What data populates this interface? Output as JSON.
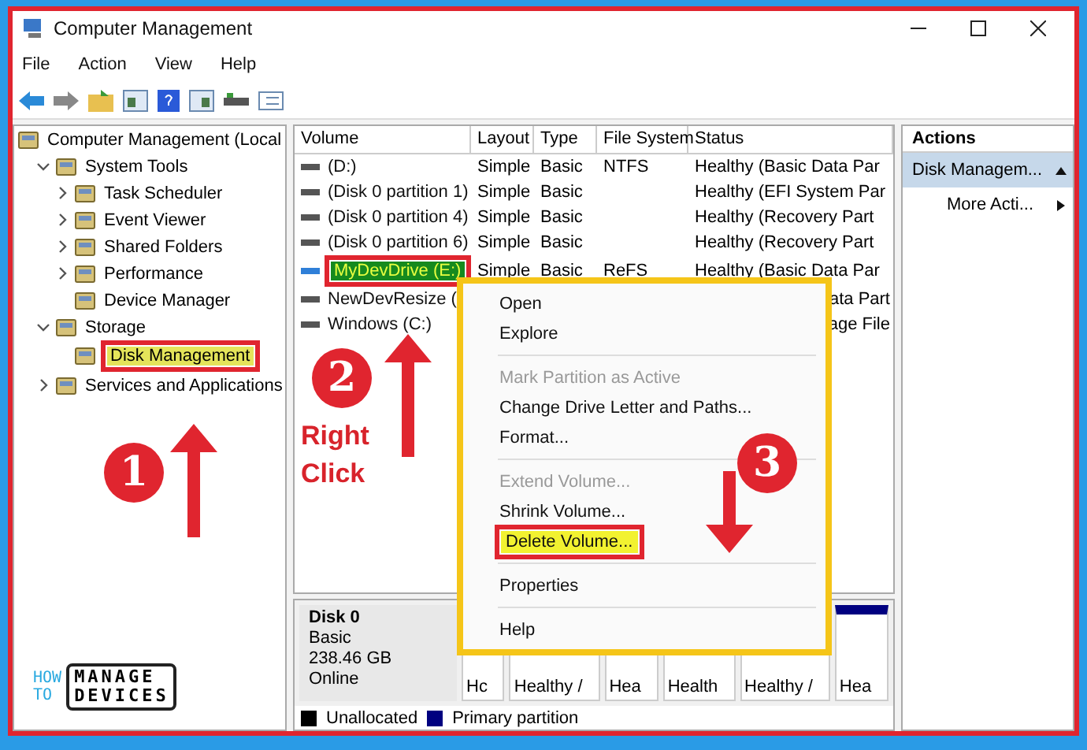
{
  "window": {
    "title": "Computer Management"
  },
  "menu": [
    "File",
    "Action",
    "View",
    "Help"
  ],
  "tree": {
    "label": "Computer Management (Local",
    "selected": false,
    "children": [
      {
        "label": "System Tools",
        "expanded": true,
        "selected": false,
        "children": [
          {
            "label": "Task Scheduler",
            "expanded": false,
            "selected": false
          },
          {
            "label": "Event Viewer",
            "expanded": false,
            "selected": false
          },
          {
            "label": "Shared Folders",
            "expanded": false,
            "selected": false
          },
          {
            "label": "Performance",
            "expanded": false,
            "selected": false
          },
          {
            "label": "Device Manager",
            "selected": false
          }
        ]
      },
      {
        "label": "Storage",
        "expanded": true,
        "selected": false,
        "children": [
          {
            "label": "Disk Management",
            "selected": true
          }
        ]
      },
      {
        "label": "Services and Applications",
        "expanded": false,
        "selected": false
      }
    ]
  },
  "table": {
    "columns": [
      "Volume",
      "Layout",
      "Type",
      "File System",
      "Status"
    ],
    "rows": [
      {
        "volume": "(D:)",
        "layout": "Simple",
        "type": "Basic",
        "file_system": "NTFS",
        "status": "Healthy (Basic Data Par",
        "selected": false
      },
      {
        "volume": "(Disk 0 partition 1)",
        "layout": "Simple",
        "type": "Basic",
        "status": "Healthy (EFI System Par",
        "selected": false
      },
      {
        "volume": "(Disk 0 partition 4)",
        "layout": "Simple",
        "type": "Basic",
        "status": "Healthy (Recovery Part",
        "selected": false
      },
      {
        "volume": "(Disk 0 partition 6)",
        "layout": "Simple",
        "type": "Basic",
        "status": "Healthy (Recovery Part",
        "selected": false
      },
      {
        "volume": "MyDevDrive (E:)",
        "layout": "Simple",
        "type": "Basic",
        "file_system": "ReFS",
        "status": "Healthy (Basic Data Par",
        "selected": true
      },
      {
        "volume": "NewDevResize (",
        "status": "ata Part",
        "selected": false
      },
      {
        "volume": "Windows (C:)",
        "status": "age File",
        "selected": false
      }
    ]
  },
  "actions": {
    "title": "Actions",
    "items": [
      {
        "label": "Disk Managem...",
        "kind": "header"
      },
      {
        "label": "More Acti...",
        "kind": "link"
      }
    ]
  },
  "disk": {
    "name": "Disk 0",
    "type": "Basic",
    "size": "238.46 GB",
    "state": "Online",
    "partitions": [
      "Hc",
      "Healthy /",
      "Hea",
      "Health",
      "Healthy /",
      "Hea"
    ]
  },
  "legend": [
    {
      "label": "Unallocated",
      "color": "#000000"
    },
    {
      "label": "Primary partition",
      "color": "#000080"
    }
  ],
  "context_menu": [
    {
      "label": "Open",
      "disabled": false,
      "highlighted": false,
      "separator_before": false
    },
    {
      "label": "Explore",
      "disabled": false,
      "highlighted": false,
      "separator_before": false
    },
    {
      "label": "Mark Partition as Active",
      "disabled": true,
      "highlighted": false,
      "separator_before": true
    },
    {
      "label": "Change Drive Letter and Paths...",
      "disabled": false,
      "highlighted": false,
      "separator_before": false
    },
    {
      "label": "Format...",
      "disabled": false,
      "highlighted": false,
      "separator_before": false
    },
    {
      "label": "Extend Volume...",
      "disabled": true,
      "highlighted": false,
      "separator_before": true
    },
    {
      "label": "Shrink Volume...",
      "disabled": false,
      "highlighted": false,
      "separator_before": false
    },
    {
      "label": "Delete Volume...",
      "disabled": false,
      "highlighted": true,
      "separator_before": false
    },
    {
      "label": "Properties",
      "disabled": false,
      "highlighted": false,
      "separator_before": true
    },
    {
      "label": "Help",
      "disabled": false,
      "highlighted": false,
      "separator_before": true
    }
  ],
  "annotations": {
    "steps": [
      "1",
      "2",
      "3"
    ],
    "note": "Right Click"
  },
  "logo": {
    "small": [
      "HOW",
      "TO"
    ],
    "big": [
      "MANAGE",
      "DEVICES"
    ]
  }
}
